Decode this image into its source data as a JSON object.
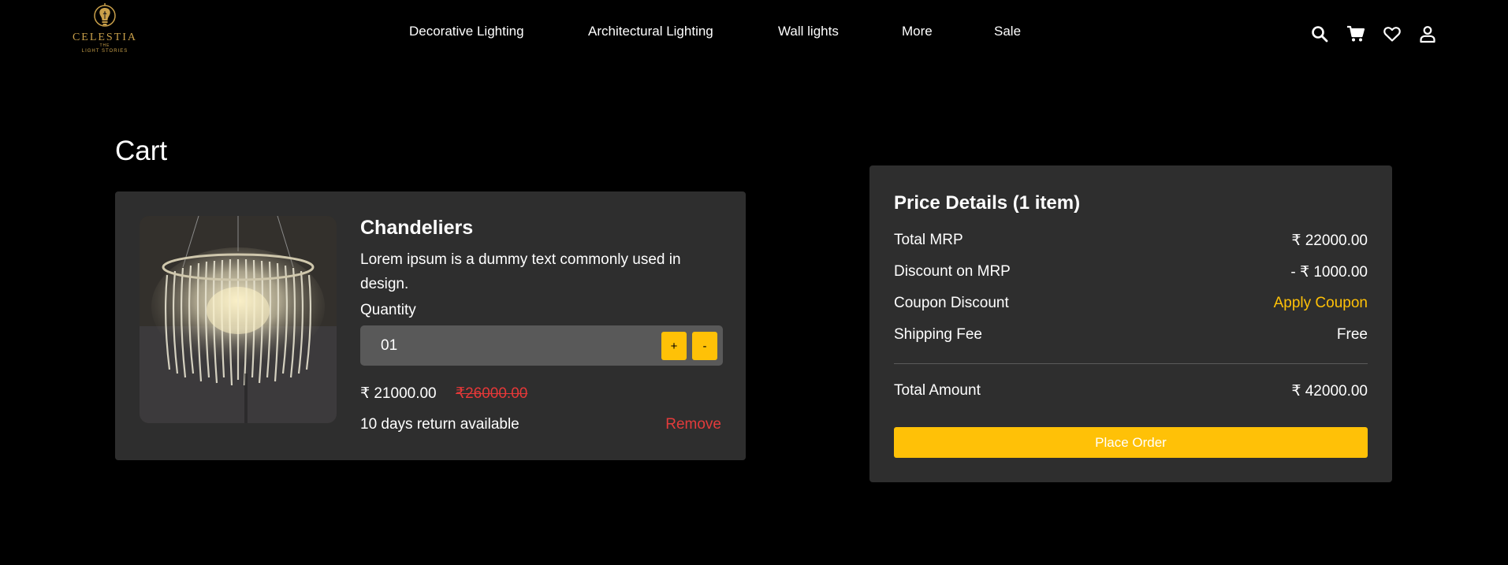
{
  "brand": {
    "name": "CELESTIA",
    "the": "THE",
    "tagline": "LIGHT STORIES",
    "color": "#c9a04a"
  },
  "nav": {
    "items": [
      "Decorative Lighting",
      "Architectural Lighting",
      "Wall lights",
      "More",
      "Sale"
    ]
  },
  "header_icons": [
    "search-icon",
    "cart-icon",
    "heart-icon",
    "user-icon"
  ],
  "page": {
    "title": "Cart"
  },
  "cart_item": {
    "name": "Chandeliers",
    "description": "Lorem ipsum is a dummy text commonly used in design.",
    "quantity_label": "Quantity",
    "quantity_value": "01",
    "plus_label": "+",
    "minus_label": "-",
    "price": "₹ 21000.00",
    "original_price": "₹26000.00",
    "return_info": "10 days return available",
    "remove_label": "Remove"
  },
  "price_details": {
    "title": "Price Details (1 item)",
    "rows": [
      {
        "label": "Total MRP",
        "value": "₹ 22000.00"
      },
      {
        "label": "Discount on MRP",
        "value": "- ₹ 1000.00"
      },
      {
        "label": "Coupon Discount",
        "value": "Apply Coupon"
      },
      {
        "label": "Shipping Fee",
        "value": "Free"
      }
    ],
    "total_label": "Total Amount",
    "total_value": "₹ 42000.00",
    "place_order_label": "Place Order"
  },
  "colors": {
    "background": "#000000",
    "card": "#2e2e2e",
    "accent": "#ffc107",
    "danger": "#e23b3b",
    "input": "#595959"
  }
}
